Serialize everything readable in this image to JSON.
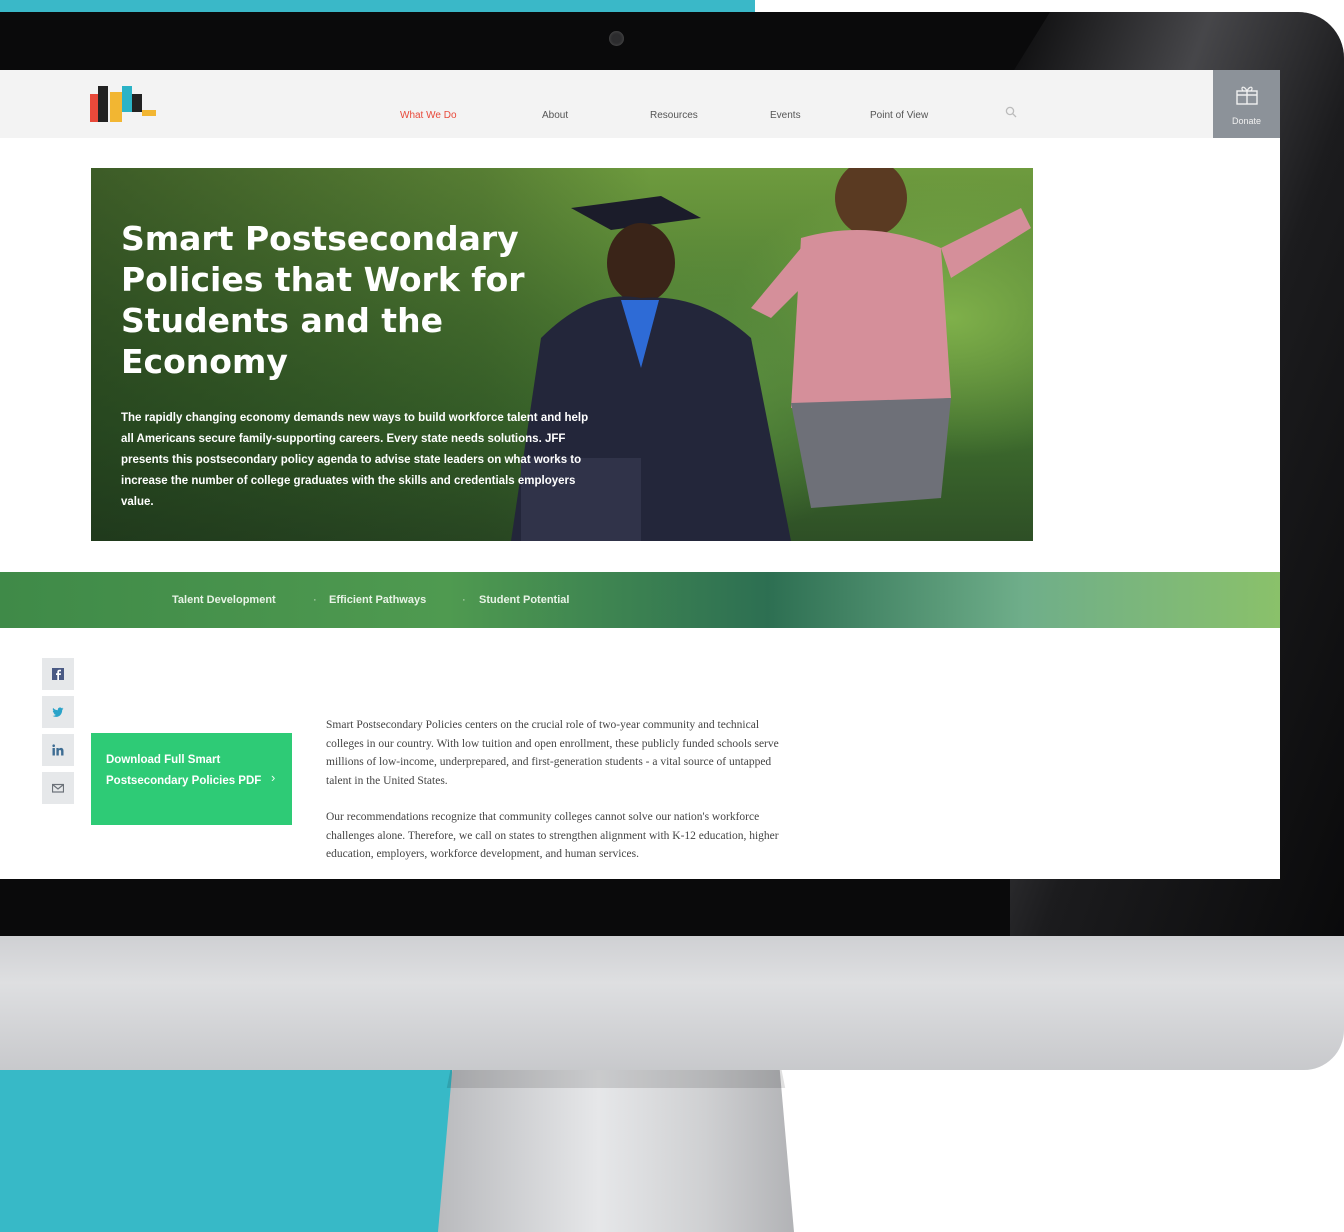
{
  "header": {
    "logo_text": "JFF",
    "nav": [
      {
        "label": "What We Do",
        "active": true
      },
      {
        "label": "About",
        "active": false
      },
      {
        "label": "Resources",
        "active": false
      },
      {
        "label": "Events",
        "active": false
      },
      {
        "label": "Point of View",
        "active": false
      }
    ],
    "donate_label": "Donate"
  },
  "hero": {
    "title": "Smart Postsecondary Policies that Work for Students and the Economy",
    "description": "The rapidly changing economy demands new ways to build workforce talent and help all Americans secure family-supporting careers. Every state needs solutions. JFF presents this postsecondary policy agenda to advise state leaders on what works to increase the number of college graduates with the skills and credentials employers value."
  },
  "breadcrumb": {
    "items": [
      "Talent Development",
      "Efficient Pathways",
      "Student Potential"
    ]
  },
  "download": {
    "label": "Download Full Smart Postsecondary Policies PDF",
    "chevron": "›"
  },
  "body": {
    "paragraphs": [
      "Smart Postsecondary Policies centers on the crucial role of two-year community and technical colleges in our country. With low tuition and open enrollment, these publicly funded schools serve millions of low-income, underprepared, and first-generation students - a vital source of untapped talent in the United States.",
      "Our recommendations recognize that community colleges cannot solve our nation's workforce challenges alone. Therefore, we call on states to strengthen alignment with K-12 education, higher education, employers, workforce development, and human services."
    ]
  },
  "colors": {
    "accent_green": "#2ecb76",
    "nav_active": "#e8493a",
    "brand_cyan": "#3ab8c8"
  }
}
